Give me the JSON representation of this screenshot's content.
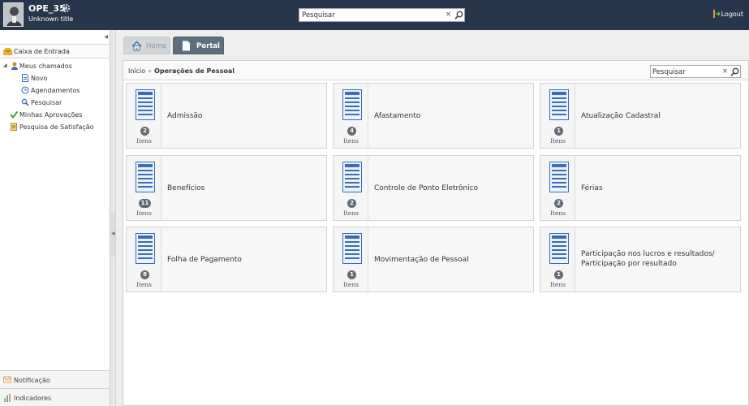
{
  "header": {
    "user_name": "OPE_35",
    "user_title": "Unknown title",
    "search_placeholder": "Pesquisar",
    "logout_label": "Logout"
  },
  "sidebar": {
    "inbox_label": "Caixa de Entrada",
    "tree": {
      "my_requests": "Meus chamados",
      "new": "Novo",
      "schedules": "Agendamentos",
      "search": "Pesquisar",
      "approvals": "Minhas Aprovações",
      "satisfaction": "Pesquisa de Satisfação"
    },
    "notification_label": "Notificação",
    "indicators_label": "Indicadores"
  },
  "tabs": {
    "home": "Home",
    "portal": "Portal"
  },
  "breadcrumb": {
    "root": "Início",
    "separator": "»",
    "current": "Operações de Pessoal"
  },
  "panel_search": {
    "placeholder": "Pesquisar"
  },
  "items_label": "Itens",
  "categories": [
    {
      "title": "Admissão",
      "count": "2"
    },
    {
      "title": "Afastamento",
      "count": "4"
    },
    {
      "title": "Atualização Cadastral",
      "count": "1"
    },
    {
      "title": "Benefícios",
      "count": "11"
    },
    {
      "title": "Controle de Ponto Eletrônico",
      "count": "2"
    },
    {
      "title": "Férias",
      "count": "2"
    },
    {
      "title": "Folha de Pagamento",
      "count": "8"
    },
    {
      "title": "Movimentação de Pessoal",
      "count": "1"
    },
    {
      "title": "Participação nos lucros e resultados/ Participação por resultado",
      "count": "1"
    }
  ],
  "colors": {
    "topbar": "#27364a",
    "active_tab": "#5d6f7f",
    "count_badge": "#5f6b77"
  }
}
